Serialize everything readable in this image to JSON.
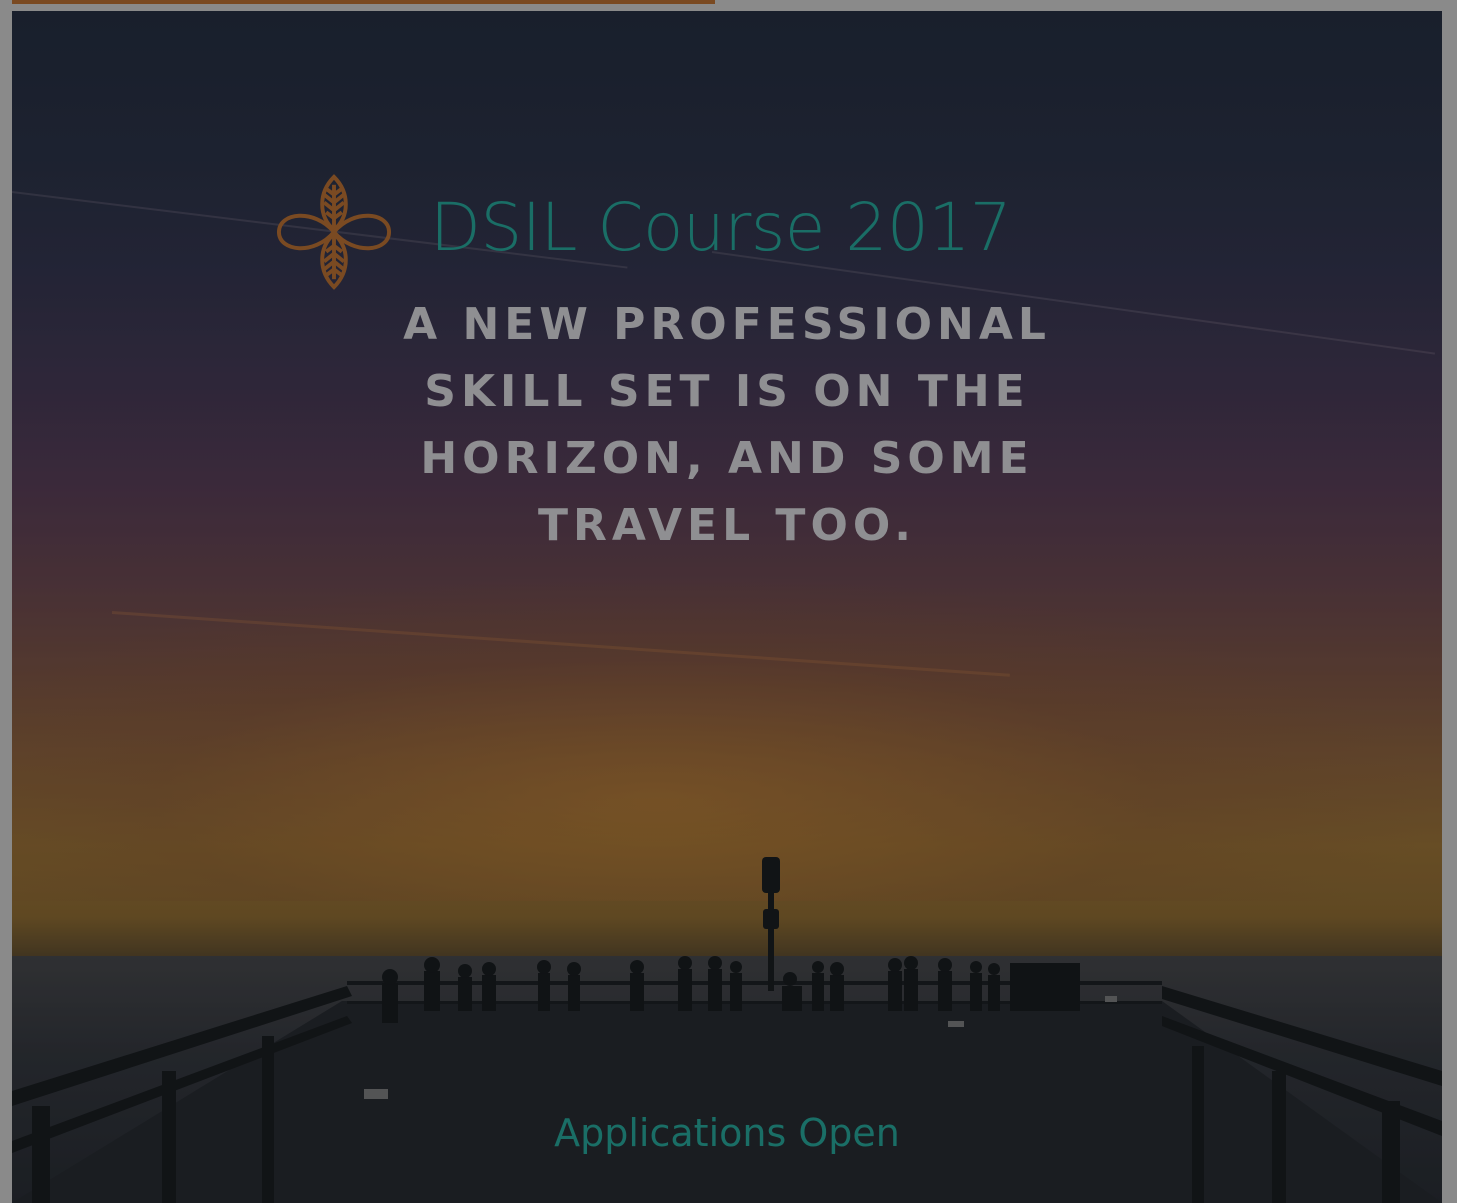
{
  "poster": {
    "title": "DSIL Course 2017",
    "headline": "A NEW PROFESSIONAL SKILL SET IS ON THE HORIZON, AND SOME TRAVEL TOO.",
    "cta": "Applications Open",
    "logo_icon": "quatrefoil-leaf-logo-icon",
    "colors": {
      "title": "#1a6e66",
      "headline": "#8f8f92",
      "logo": "#7a4a22",
      "top_bar": "#7a4a22",
      "frame": "#8a8a8a"
    }
  }
}
